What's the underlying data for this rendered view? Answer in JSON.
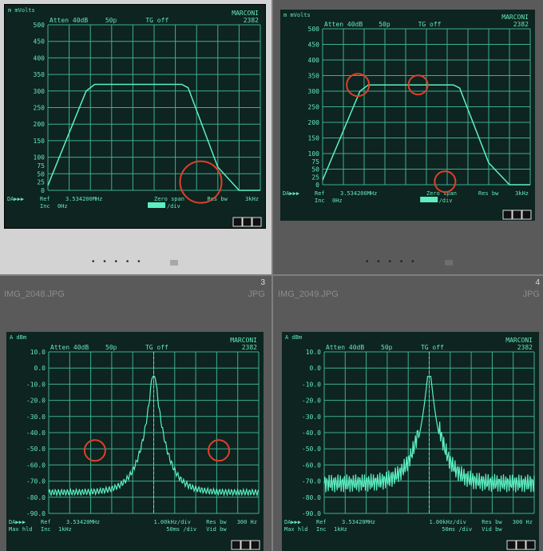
{
  "thumbnails": [
    {
      "index": "",
      "filename": "",
      "filetype": "",
      "selected": true,
      "screen": {
        "unit_label": "m mVolts",
        "top_line": [
          "Atten 40dB",
          "50p",
          "TG off"
        ],
        "brand": [
          "MARCONI",
          "2382"
        ],
        "y_ticks": [
          "500",
          "450",
          "400",
          "350",
          "300",
          "250",
          "200",
          "150",
          "100",
          "75",
          "50",
          "25",
          "0"
        ],
        "ref_label": "Ref",
        "ref_value": "3.534200MHz",
        "inc_label": "Inc",
        "inc_value": "0Hz",
        "span_label": "Zero span",
        "span_value": "/div",
        "res_label": "Res bw",
        "res_value": "3kHz",
        "da_label": "DA▶▶▶",
        "circles": 1
      }
    },
    {
      "index": "",
      "filename": "",
      "filetype": "",
      "selected": false,
      "screen": {
        "unit_label": "m mVolts",
        "top_line": [
          "Atten 40dB",
          "50p",
          "TG off"
        ],
        "brand": [
          "MARCONI",
          "2382"
        ],
        "y_ticks": [
          "500",
          "450",
          "400",
          "350",
          "300",
          "250",
          "200",
          "150",
          "100",
          "75",
          "50",
          "25",
          "0"
        ],
        "ref_label": "Ref",
        "ref_value": "3.534200MHz",
        "inc_label": "Inc",
        "inc_value": "0Hz",
        "span_label": "Zero span",
        "span_value": "/div",
        "res_label": "Res bw",
        "res_value": "3kHz",
        "da_label": "DA▶▶▶",
        "circles": 3
      }
    },
    {
      "index": "3",
      "filename": "IMG_2048.JPG",
      "filetype": "JPG",
      "selected": false,
      "screen": {
        "unit_label": "A dBm",
        "top_line": [
          "Atten 40dB",
          "50p",
          "TG off"
        ],
        "brand": [
          "MARCONI",
          "2382"
        ],
        "y_ticks": [
          "10.0",
          "0.0",
          "-10.0",
          "-20.0",
          "-30.0",
          "-40.0",
          "-50.0",
          "-60.0",
          "-70.0",
          "-80.0",
          "-90.0"
        ],
        "ref_label": "Ref",
        "ref_value": "3.53420MHz",
        "inc_label": "Inc",
        "inc_value": "1kHz",
        "span_label": "1.00kHz/div",
        "span_value": "50ms /div",
        "res_label": "Res bw",
        "res_value": "300 Hz",
        "vid_label": "Vid bw",
        "da_label": "DA▶▶▶",
        "extra_label": "Max hld",
        "circles": 2
      }
    },
    {
      "index": "4",
      "filename": "IMG_2049.JPG",
      "filetype": "JPG",
      "selected": false,
      "screen": {
        "unit_label": "A dBm",
        "top_line": [
          "Atten 40dB",
          "50p",
          "TG off"
        ],
        "brand": [
          "MARCONI",
          "2382"
        ],
        "y_ticks": [
          "10.0",
          "0.0",
          "-10.0",
          "-20.0",
          "-30.0",
          "-40.0",
          "-50.0",
          "-60.0",
          "-70.0",
          "-80.0",
          "-90.0"
        ],
        "ref_label": "Ref",
        "ref_value": "3.53420MHz",
        "inc_label": "Inc",
        "inc_value": "1kHz",
        "span_label": "1.00kHz/div",
        "span_value": "50ms /div",
        "res_label": "Res bw",
        "res_value": "300 Hz",
        "vid_label": "Vid bw",
        "da_label": "DA▶▶▶",
        "extra_label": "Max hld",
        "circles": 0
      }
    }
  ],
  "dots": "• • • • •",
  "colors": {
    "screen_bg": "#0d2420",
    "trace": "#5cf0c0",
    "grid": "#3fae8f",
    "text": "#66e8b8",
    "circle": "#e0402a"
  }
}
